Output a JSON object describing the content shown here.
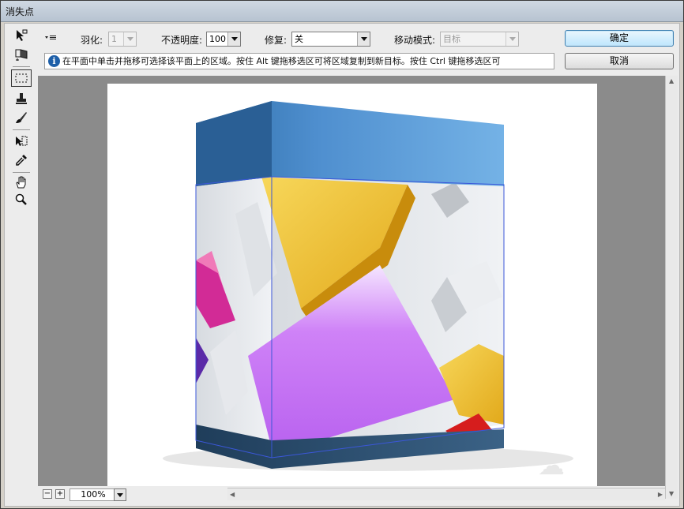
{
  "window": {
    "title": "消失点"
  },
  "options": {
    "menu_icon": "panel-menu-icon",
    "feather_label": "羽化:",
    "feather_value": "1",
    "opacity_label": "不透明度:",
    "opacity_value": "100",
    "heal_label": "修复:",
    "heal_value": "关",
    "move_mode_label": "移动模式:",
    "move_mode_value": "目标"
  },
  "buttons": {
    "ok": "确定",
    "cancel": "取消"
  },
  "info": {
    "icon": "info-icon",
    "text": "在平面中单击并拖移可选择该平面上的区域。按住 Alt 键拖移选区可将区域复制到新目标。按住 Ctrl 键拖移选区可"
  },
  "tools": [
    "edit-plane-icon",
    "create-plane-icon",
    "marquee-icon",
    "stamp-icon",
    "brush-icon",
    "transform-icon",
    "eyedropper-icon",
    "hand-icon",
    "zoom-icon"
  ],
  "zoom": {
    "value": "100%",
    "minus": "−",
    "plus": "+"
  },
  "colors": {
    "box_top": "#5c9bd6",
    "box_purple": "#c66df2",
    "box_yellow": "#f2c23c",
    "box_bottom": "#2e4d6c",
    "plane_grid": "#3b57d9"
  }
}
